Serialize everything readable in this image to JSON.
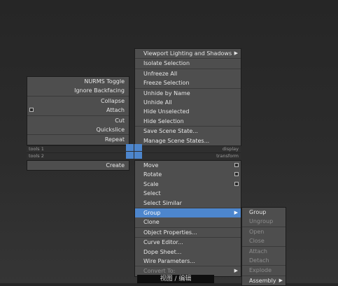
{
  "quad_top_right": [
    {
      "label": "Viewport Lighting and Shadows",
      "submenu": true
    },
    {
      "label": "Isolate Selection",
      "sep": true
    },
    {
      "label": "Unfreeze All",
      "sep": true
    },
    {
      "label": "Freeze Selection"
    },
    {
      "label": "Unhide by Name",
      "sep": true
    },
    {
      "label": "Unhide All"
    },
    {
      "label": "Hide Unselected"
    },
    {
      "label": "Hide Selection"
    },
    {
      "label": "Save Scene State...",
      "sep": true
    },
    {
      "label": "Manage Scene States..."
    }
  ],
  "quad_top_left": [
    {
      "label": "NURMS Toggle"
    },
    {
      "label": "Ignore Backfacing"
    },
    {
      "label": "Collapse",
      "sep": true
    },
    {
      "label": "Attach",
      "box": true
    },
    {
      "label": "Cut",
      "sep": true
    },
    {
      "label": "Quickslice"
    },
    {
      "label": "Repeat",
      "sep": true
    }
  ],
  "quad_labels": {
    "tools1": "tools 1",
    "display": "display",
    "tools2": "tools 2",
    "transform": "transform"
  },
  "quad_bottom_left": [
    {
      "label": "Create"
    }
  ],
  "quad_bottom_right": [
    {
      "label": "Move",
      "box": true
    },
    {
      "label": "Rotate",
      "box": true
    },
    {
      "label": "Scale",
      "box": true
    },
    {
      "label": "Select"
    },
    {
      "label": "Select Similar"
    },
    {
      "label": "Group",
      "submenu": true,
      "highlight": true,
      "sep": true
    },
    {
      "label": "Clone"
    },
    {
      "label": "Object Properties...",
      "sep": true
    },
    {
      "label": "Curve Editor...",
      "sep": true
    },
    {
      "label": "Dope Sheet..."
    },
    {
      "label": "Wire Parameters..."
    },
    {
      "label": "Convert To:",
      "submenu": true,
      "disabled": true,
      "sep": true
    }
  ],
  "group_submenu": [
    {
      "label": "Group"
    },
    {
      "label": "Ungroup",
      "disabled": true
    },
    {
      "label": "Open",
      "disabled": true,
      "sep": true
    },
    {
      "label": "Close",
      "disabled": true
    },
    {
      "label": "Attach",
      "disabled": true,
      "sep": true
    },
    {
      "label": "Detach",
      "disabled": true
    },
    {
      "label": "Explode",
      "disabled": true,
      "sep": true
    },
    {
      "label": "Assembly",
      "submenu": true,
      "sep": true
    }
  ],
  "caption": "视图 / 编辑",
  "colors": {
    "highlight": "#4d86cd",
    "menu_bg": "#4e4e4e",
    "text": "#e6e6e6",
    "disabled_text": "#8d8d8d"
  }
}
